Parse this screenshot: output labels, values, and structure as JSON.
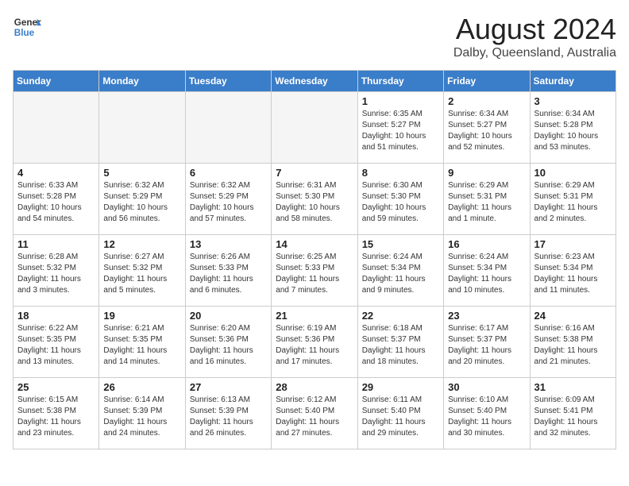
{
  "header": {
    "logo_general": "General",
    "logo_blue": "Blue",
    "title": "August 2024",
    "location": "Dalby, Queensland, Australia"
  },
  "days_of_week": [
    "Sunday",
    "Monday",
    "Tuesday",
    "Wednesday",
    "Thursday",
    "Friday",
    "Saturday"
  ],
  "weeks": [
    [
      {
        "day": "",
        "empty": true
      },
      {
        "day": "",
        "empty": true
      },
      {
        "day": "",
        "empty": true
      },
      {
        "day": "",
        "empty": true
      },
      {
        "day": "1",
        "sunrise": "6:35 AM",
        "sunset": "5:27 PM",
        "daylight": "10 hours and 51 minutes."
      },
      {
        "day": "2",
        "sunrise": "6:34 AM",
        "sunset": "5:27 PM",
        "daylight": "10 hours and 52 minutes."
      },
      {
        "day": "3",
        "sunrise": "6:34 AM",
        "sunset": "5:28 PM",
        "daylight": "10 hours and 53 minutes."
      }
    ],
    [
      {
        "day": "4",
        "sunrise": "6:33 AM",
        "sunset": "5:28 PM",
        "daylight": "10 hours and 54 minutes."
      },
      {
        "day": "5",
        "sunrise": "6:32 AM",
        "sunset": "5:29 PM",
        "daylight": "10 hours and 56 minutes."
      },
      {
        "day": "6",
        "sunrise": "6:32 AM",
        "sunset": "5:29 PM",
        "daylight": "10 hours and 57 minutes."
      },
      {
        "day": "7",
        "sunrise": "6:31 AM",
        "sunset": "5:30 PM",
        "daylight": "10 hours and 58 minutes."
      },
      {
        "day": "8",
        "sunrise": "6:30 AM",
        "sunset": "5:30 PM",
        "daylight": "10 hours and 59 minutes."
      },
      {
        "day": "9",
        "sunrise": "6:29 AM",
        "sunset": "5:31 PM",
        "daylight": "11 hours and 1 minute."
      },
      {
        "day": "10",
        "sunrise": "6:29 AM",
        "sunset": "5:31 PM",
        "daylight": "11 hours and 2 minutes."
      }
    ],
    [
      {
        "day": "11",
        "sunrise": "6:28 AM",
        "sunset": "5:32 PM",
        "daylight": "11 hours and 3 minutes."
      },
      {
        "day": "12",
        "sunrise": "6:27 AM",
        "sunset": "5:32 PM",
        "daylight": "11 hours and 5 minutes."
      },
      {
        "day": "13",
        "sunrise": "6:26 AM",
        "sunset": "5:33 PM",
        "daylight": "11 hours and 6 minutes."
      },
      {
        "day": "14",
        "sunrise": "6:25 AM",
        "sunset": "5:33 PM",
        "daylight": "11 hours and 7 minutes."
      },
      {
        "day": "15",
        "sunrise": "6:24 AM",
        "sunset": "5:34 PM",
        "daylight": "11 hours and 9 minutes."
      },
      {
        "day": "16",
        "sunrise": "6:24 AM",
        "sunset": "5:34 PM",
        "daylight": "11 hours and 10 minutes."
      },
      {
        "day": "17",
        "sunrise": "6:23 AM",
        "sunset": "5:34 PM",
        "daylight": "11 hours and 11 minutes."
      }
    ],
    [
      {
        "day": "18",
        "sunrise": "6:22 AM",
        "sunset": "5:35 PM",
        "daylight": "11 hours and 13 minutes."
      },
      {
        "day": "19",
        "sunrise": "6:21 AM",
        "sunset": "5:35 PM",
        "daylight": "11 hours and 14 minutes."
      },
      {
        "day": "20",
        "sunrise": "6:20 AM",
        "sunset": "5:36 PM",
        "daylight": "11 hours and 16 minutes."
      },
      {
        "day": "21",
        "sunrise": "6:19 AM",
        "sunset": "5:36 PM",
        "daylight": "11 hours and 17 minutes."
      },
      {
        "day": "22",
        "sunrise": "6:18 AM",
        "sunset": "5:37 PM",
        "daylight": "11 hours and 18 minutes."
      },
      {
        "day": "23",
        "sunrise": "6:17 AM",
        "sunset": "5:37 PM",
        "daylight": "11 hours and 20 minutes."
      },
      {
        "day": "24",
        "sunrise": "6:16 AM",
        "sunset": "5:38 PM",
        "daylight": "11 hours and 21 minutes."
      }
    ],
    [
      {
        "day": "25",
        "sunrise": "6:15 AM",
        "sunset": "5:38 PM",
        "daylight": "11 hours and 23 minutes."
      },
      {
        "day": "26",
        "sunrise": "6:14 AM",
        "sunset": "5:39 PM",
        "daylight": "11 hours and 24 minutes."
      },
      {
        "day": "27",
        "sunrise": "6:13 AM",
        "sunset": "5:39 PM",
        "daylight": "11 hours and 26 minutes."
      },
      {
        "day": "28",
        "sunrise": "6:12 AM",
        "sunset": "5:40 PM",
        "daylight": "11 hours and 27 minutes."
      },
      {
        "day": "29",
        "sunrise": "6:11 AM",
        "sunset": "5:40 PM",
        "daylight": "11 hours and 29 minutes."
      },
      {
        "day": "30",
        "sunrise": "6:10 AM",
        "sunset": "5:40 PM",
        "daylight": "11 hours and 30 minutes."
      },
      {
        "day": "31",
        "sunrise": "6:09 AM",
        "sunset": "5:41 PM",
        "daylight": "11 hours and 32 minutes."
      }
    ]
  ]
}
